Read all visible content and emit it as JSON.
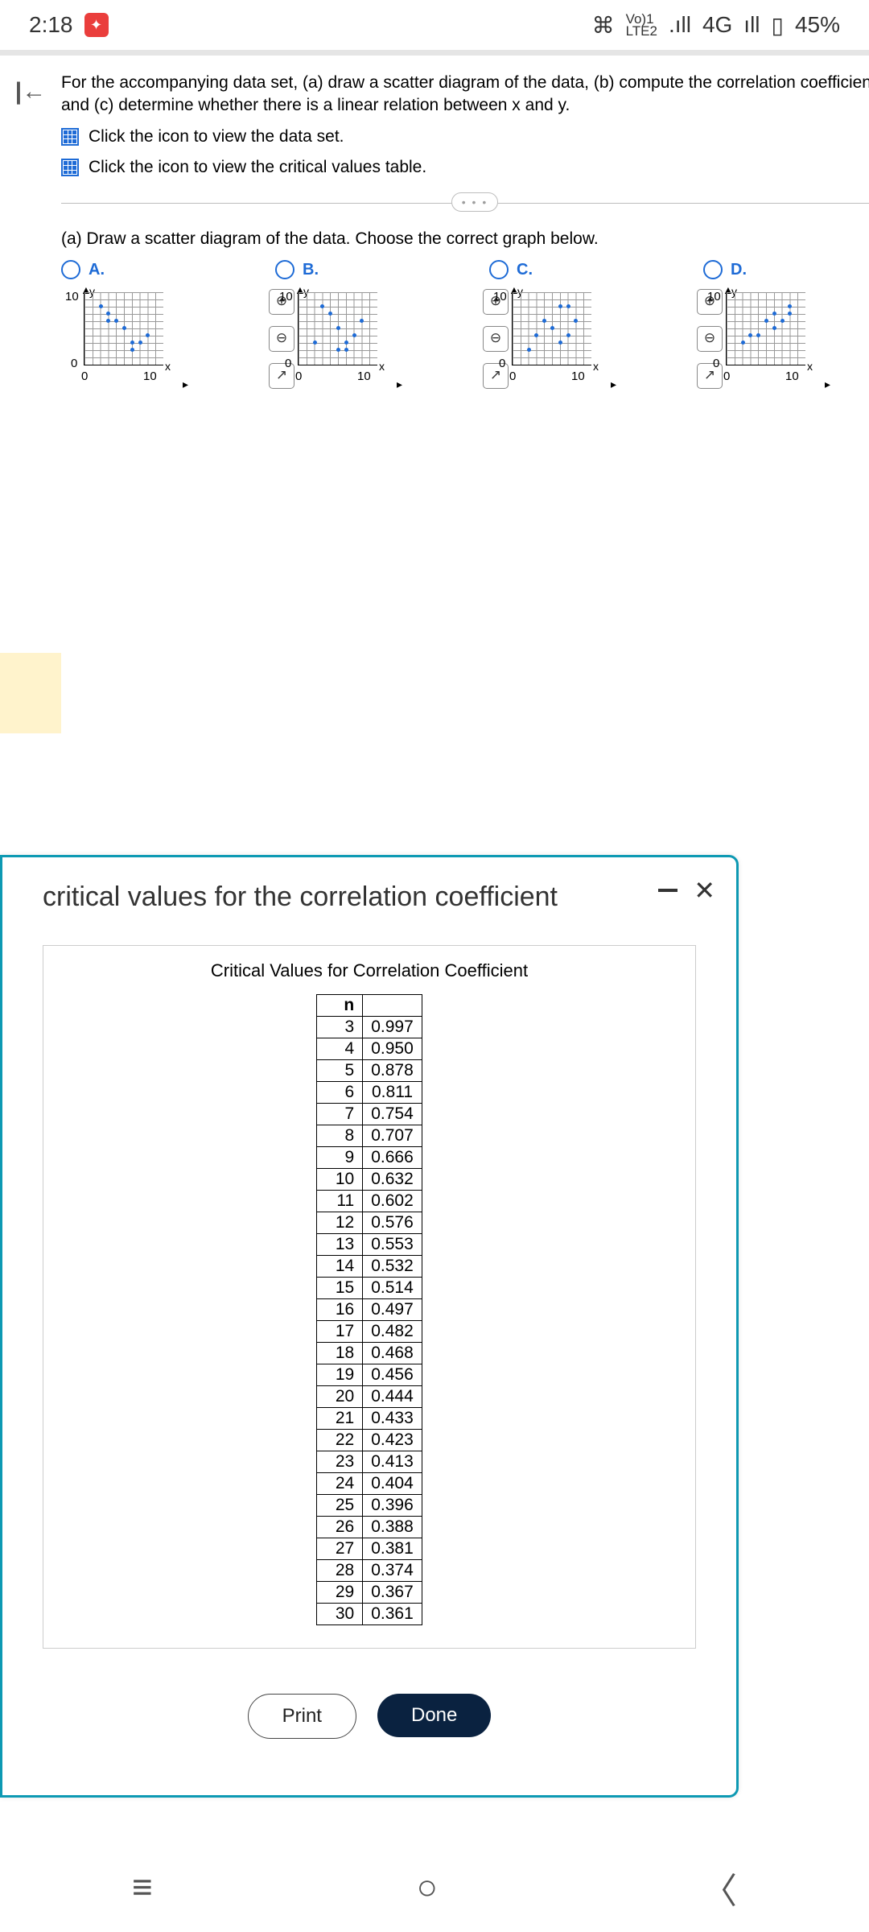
{
  "status": {
    "time": "2:18",
    "key": "⌘",
    "net1": "Vo)1",
    "net2": "LTE2",
    "sig": ".ıll",
    "net3": "4G",
    "sig2": "ıll",
    "battery": "45%"
  },
  "question": {
    "prompt": "For the accompanying data set, (a) draw a scatter diagram of the data, (b) compute the correlation coefficient, and (c) determine whether there is a linear relation between x and y.",
    "link1": "Click the icon to view the data set.",
    "link2": "Click the icon to view the critical values table.",
    "partA": "(a) Draw a scatter diagram of the data. Choose the correct graph below."
  },
  "options": {
    "a": "A.",
    "b": "B.",
    "c": "C.",
    "d": "D."
  },
  "axes": {
    "y": "y",
    "x": "x",
    "t10": "10",
    "t0": "0"
  },
  "chart_data": [
    {
      "type": "scatter",
      "label": "A",
      "xlim": [
        0,
        10
      ],
      "ylim": [
        0,
        10
      ],
      "points": [
        [
          2,
          8
        ],
        [
          3,
          7
        ],
        [
          3,
          6
        ],
        [
          4,
          6
        ],
        [
          5,
          5
        ],
        [
          6,
          3
        ],
        [
          6,
          2
        ],
        [
          7,
          3
        ],
        [
          8,
          4
        ]
      ]
    },
    {
      "type": "scatter",
      "label": "B",
      "xlim": [
        0,
        10
      ],
      "ylim": [
        0,
        10
      ],
      "points": [
        [
          2,
          3
        ],
        [
          3,
          8
        ],
        [
          4,
          7
        ],
        [
          5,
          2
        ],
        [
          5,
          5
        ],
        [
          6,
          3
        ],
        [
          6,
          2
        ],
        [
          7,
          4
        ],
        [
          8,
          6
        ]
      ]
    },
    {
      "type": "scatter",
      "label": "C",
      "xlim": [
        0,
        10
      ],
      "ylim": [
        0,
        10
      ],
      "points": [
        [
          2,
          2
        ],
        [
          3,
          4
        ],
        [
          4,
          6
        ],
        [
          5,
          5
        ],
        [
          6,
          3
        ],
        [
          6,
          8
        ],
        [
          7,
          8
        ],
        [
          7,
          4
        ],
        [
          8,
          6
        ]
      ]
    },
    {
      "type": "scatter",
      "label": "D",
      "xlim": [
        0,
        10
      ],
      "ylim": [
        0,
        10
      ],
      "points": [
        [
          2,
          3
        ],
        [
          3,
          4
        ],
        [
          4,
          4
        ],
        [
          5,
          6
        ],
        [
          6,
          5
        ],
        [
          6,
          7
        ],
        [
          7,
          6
        ],
        [
          8,
          8
        ],
        [
          8,
          7
        ]
      ]
    }
  ],
  "overlay": {
    "title": "critical values for the correlation coefficient",
    "subtitle": "Critical Values for Correlation Coefficient",
    "header_n": "n",
    "rows": [
      [
        "3",
        "0.997"
      ],
      [
        "4",
        "0.950"
      ],
      [
        "5",
        "0.878"
      ],
      [
        "6",
        "0.811"
      ],
      [
        "7",
        "0.754"
      ],
      [
        "8",
        "0.707"
      ],
      [
        "9",
        "0.666"
      ],
      [
        "10",
        "0.632"
      ],
      [
        "11",
        "0.602"
      ],
      [
        "12",
        "0.576"
      ],
      [
        "13",
        "0.553"
      ],
      [
        "14",
        "0.532"
      ],
      [
        "15",
        "0.514"
      ],
      [
        "16",
        "0.497"
      ],
      [
        "17",
        "0.482"
      ],
      [
        "18",
        "0.468"
      ],
      [
        "19",
        "0.456"
      ],
      [
        "20",
        "0.444"
      ],
      [
        "21",
        "0.433"
      ],
      [
        "22",
        "0.423"
      ],
      [
        "23",
        "0.413"
      ],
      [
        "24",
        "0.404"
      ],
      [
        "25",
        "0.396"
      ],
      [
        "26",
        "0.388"
      ],
      [
        "27",
        "0.381"
      ],
      [
        "28",
        "0.374"
      ],
      [
        "29",
        "0.367"
      ],
      [
        "30",
        "0.361"
      ]
    ],
    "print": "Print",
    "done": "Done"
  }
}
